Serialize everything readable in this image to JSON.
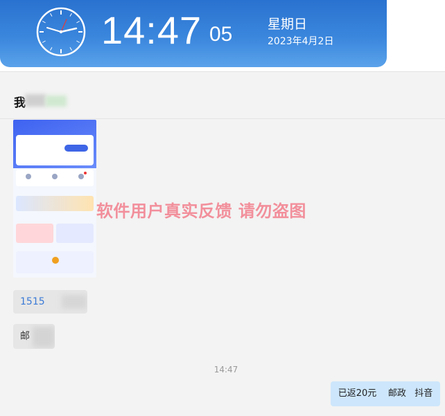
{
  "clock": {
    "time": "14:47",
    "seconds": "05",
    "weekday": "星期日",
    "date": "2023年4月2日"
  },
  "chat": {
    "title": "我",
    "messages": {
      "phone_partial": "1515",
      "mail_partial": "邮",
      "timestamp": "14:47",
      "reply": "已返20元    邮政   抖音"
    },
    "watermark": "软件用户真实反馈  请勿盗图"
  },
  "colors": {
    "banner": "#3a86dd",
    "reply_bubble": "#cde6fb",
    "watermark": "#f28f9b"
  }
}
